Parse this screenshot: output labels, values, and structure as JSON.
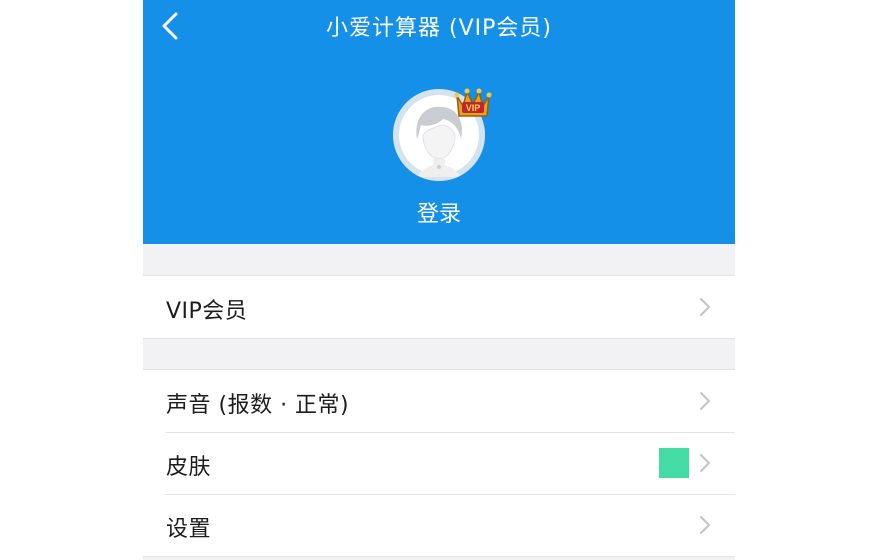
{
  "colors": {
    "header_bg": "#1590e8",
    "page_bg": "#f2f2f4",
    "skin_swatch": "#45dba4",
    "crown": "#d9a21d",
    "chevron": "#c4c4c8"
  },
  "header": {
    "back_icon": "chevron-left-icon",
    "title": "小爱计算器 (VIP会员)",
    "login_label": "登录",
    "avatar_icon": "default-avatar-icon",
    "badge_icon": "vip-crown-icon",
    "badge_text": "VIP"
  },
  "menu": {
    "vip": {
      "label": "VIP会员",
      "icon": "chevron-right-icon"
    },
    "sound": {
      "label": "声音 (报数 · 正常)",
      "icon": "chevron-right-icon"
    },
    "skin": {
      "label": "皮肤",
      "icon": "chevron-right-icon"
    },
    "settings": {
      "label": "设置",
      "icon": "chevron-right-icon"
    }
  }
}
